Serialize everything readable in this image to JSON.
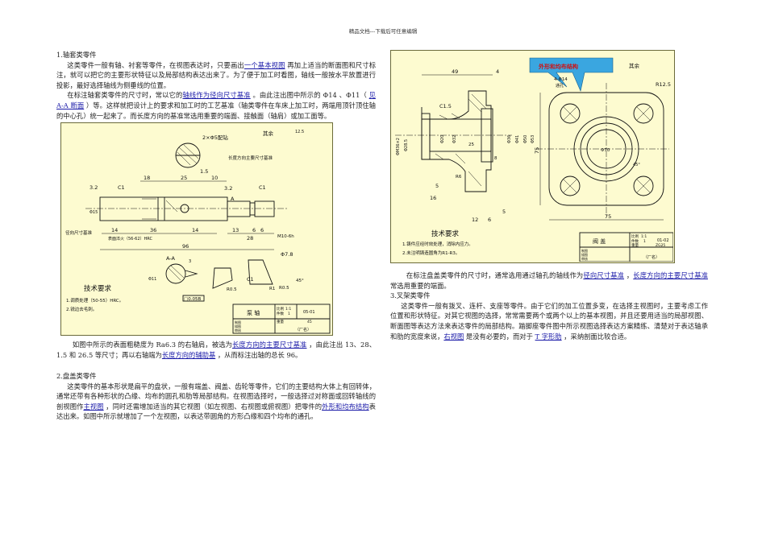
{
  "header": "精品文档---下载后可任意编辑",
  "sec1": {
    "title": "1.轴套类零件",
    "p1": "这类零件一般有轴、衬套等零件，在视图表达时，只要画出",
    "p1_link": "一个基本视图",
    "p1_rest": " 再加上适当的断面图和尺寸标注，就可以把它的主要形状特征以及局部结构表达出来了。为了便于加工时看图，轴线一般按水平放置进行投影，最好选择轴线为侧垂线的位置。",
    "p2": "在标注轴套类零件的尺寸时，常以它的",
    "p2_link1": "轴线作为径向尺寸基准",
    "p2_mid": " 。由此注出图中所示的 Φ14 、Φ11（ ",
    "p2_link2": "见 A-A 断面",
    "p2_rest": " ）等。这样就把设计上的要求和加工时的工艺基准（轴类零件在车床上加工时，两端用顶针顶住轴的中心孔）统一起来了。而长度方向的基准常选用重要的端面、接触面（轴肩）或加工面等。",
    "p3": "如图中所示的表面粗糙度为 Ra6.3 的右轴肩，被选为",
    "p3_link1": "长度方向的主要尺寸基准",
    "p3_mid": " ，由此注出 13、28、1.5 和 26.5 等尺寸；再以右轴端为",
    "p3_link2": "长度方向的辅助基",
    "p3_rest": " ，从而标注出轴的总长 96。"
  },
  "sec2": {
    "title": "2.盘盖类零件",
    "p1": "这类零件的基本形状是扁平的盘状，一般有端盖、阀盖、齿轮等零件，它们的主要结构大体上有回转体，通常还带有各种形状的凸缘、均布的圆孔和肋等局部结构。在视图选择时，一般选择过对称面或回转轴线的剖视图作",
    "p1_link1": "主视图",
    "p1_mid": " ，同时还需增加适当的其它视图（如左视图、右视图或俯视图）把零件的",
    "p1_link2": "外形和均布结构",
    "p1_rest": "表达出来。如图中所示就增加了一个左视图，以表达带圆角的方形凸缘和四个均布的通孔。",
    "p2": "在标注盘盖类零件的尺寸时，通常选用通过轴孔的轴线作为",
    "p2_link1": "径向尺寸基准",
    "p2_mid": " ，",
    "p2_link2": "长度方向的主要尺寸基准",
    "p2_rest": "常选用重要的端面。"
  },
  "sec3": {
    "title": "3.叉架类零件",
    "p1": "这类零件一般有拨叉、连杆、支座等零件。由于它们的加工位置多变，在选择主视图时，主要考虑工作位置和形状特征。对其它视图的选择，常常需要两个或两个以上的基本视图，并且还要用适当的局部视图、断面图等表达方法来表达零件的局部结构。踏脚座零件图中所示视图选择表达方案精练、清楚对于表达轴承和肋的宽度来说，",
    "p1_link1": "右视图",
    "p1_mid": " 是没有必要的，而对于 ",
    "p1_link2": "T 字形肋",
    "p1_rest": " ，采纳剖面比较合适。"
  },
  "fig1": {
    "surface_note": "其余",
    "rough_main": "12.5",
    "holes": "2×Φ5配钻",
    "datum_len": "长度方向主要尺寸基准",
    "datum_rad": "径向尺寸基准",
    "dims": [
      "18",
      "25",
      "10",
      "1.5",
      "C1",
      "C1",
      "3.2",
      "3.2",
      "14",
      "36",
      "14",
      "13",
      "6",
      "6",
      "28",
      "96",
      "Φ15",
      "M10-6h",
      "Φ7.8",
      "R0.5",
      "R0.5",
      "R1",
      "45°",
      "C1",
      "Φ11",
      "3",
      "A-A",
      "A"
    ],
    "harden": "表面淬火（56-62）HRC",
    "tol": "□0.05B",
    "tech_title": "技术要求",
    "tech": [
      "1.调质处理（50-55）HRC。",
      "2.锐边去毛刺。"
    ],
    "tb_name": "泵 轴",
    "tb_scale_l": "比例",
    "tb_scale": "1:1",
    "tb_qty_l": "件数",
    "tb_qty": "1",
    "tb_mat_l": "重量",
    "tb_mat": "45",
    "tb_code": "05-01",
    "tb_rows": [
      "制图",
      "描图",
      "审核"
    ],
    "tb_factory": "（厂名）"
  },
  "fig2": {
    "callout": "外形和均布结构",
    "callout_color": "#3aa6e0",
    "surface_note": "其余",
    "holes": "4-Φ14",
    "holes2": "通孔",
    "dims": [
      "49",
      "4",
      "C1.5",
      "ΦM36×2",
      "Φ28.5",
      "Φ20",
      "Φ32",
      "Φ36",
      "Φ41",
      "Φ50",
      "Φ53",
      "5",
      "16",
      "12",
      "6",
      "5",
      "R6",
      "8",
      "25",
      "75",
      "75",
      "R12.5",
      "Φ70",
      "45°"
    ],
    "tech_title": "技术要求",
    "tech": [
      "1.铸件应经时效处理，消除内应力。",
      "2.未注明铸造圆角为R1-R3。"
    ],
    "tb_name": "阀 盖",
    "tb_scale_l": "比例",
    "tb_scale": "1:1",
    "tb_qty_l": "件数",
    "tb_qty": "1",
    "tb_mat_l": "重量",
    "tb_mat": "ZG25",
    "tb_code": "01-02",
    "tb_rows": [
      "制图",
      "描图",
      "审核"
    ],
    "tb_factory": "（厂名）"
  }
}
